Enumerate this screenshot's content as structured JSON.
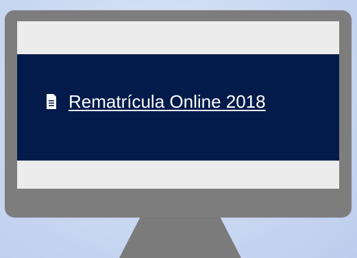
{
  "background": {
    "color": "#c9d9f3"
  },
  "monitor": {
    "frame_color": "#7d7d7d",
    "screen_color": "#ececec",
    "banner_color": "#021b4b"
  },
  "content": {
    "link_text": "Rematrícula Online 2018",
    "link_icon": "document-icon"
  },
  "colors": {
    "link": "#ffffff"
  }
}
